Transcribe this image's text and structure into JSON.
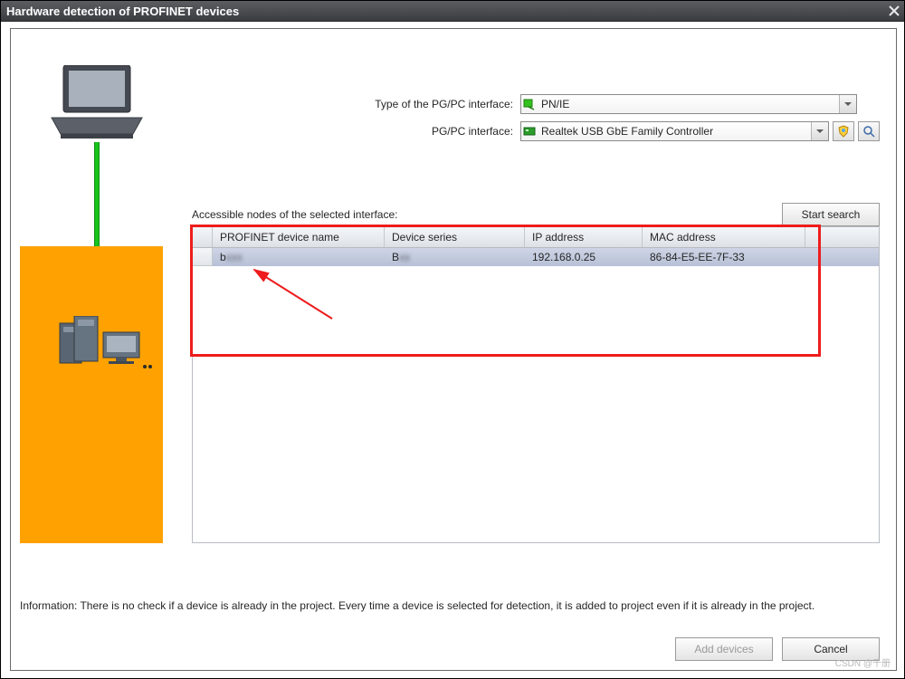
{
  "window": {
    "title": "Hardware detection of PROFINET devices"
  },
  "form": {
    "type_label": "Type of the PG/PC interface:",
    "type_value": "PN/IE",
    "iface_label": "PG/PC interface:",
    "iface_value": "Realtek USB GbE Family Controller"
  },
  "nodes": {
    "section_label": "Accessible nodes of the selected interface:",
    "start_search": "Start search",
    "columns": {
      "name": "PROFINET device name",
      "series": "Device series",
      "ip": "IP address",
      "mac": "MAC address"
    },
    "rows": [
      {
        "name": "b",
        "series": "B",
        "ip": "192.168.0.25",
        "mac": "86-84-E5-EE-7F-33"
      }
    ]
  },
  "info_text": "Information: There is no check if a device is already in the project. Every time a device is selected for detection, it is added to project even if it is already in the project.",
  "buttons": {
    "add": "Add devices",
    "cancel": "Cancel"
  },
  "watermark": "CSDN @千册"
}
